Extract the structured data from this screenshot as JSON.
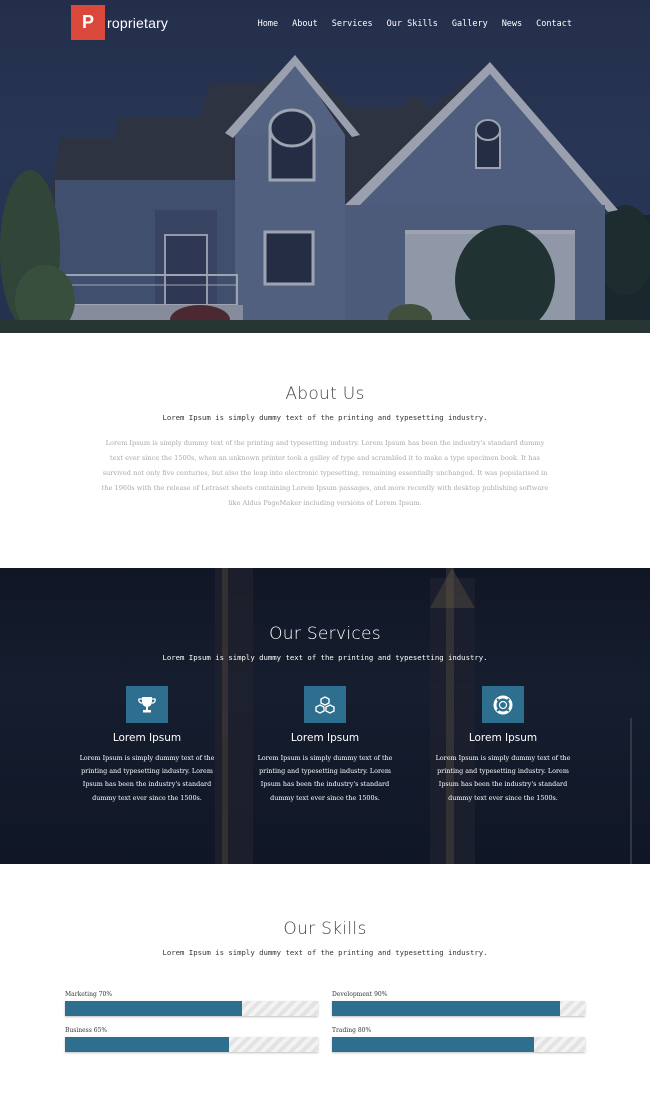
{
  "brand": {
    "initial": "P",
    "rest": "roprietary",
    "accent": "#d9483b"
  },
  "nav": [
    {
      "label": "Home"
    },
    {
      "label": "About"
    },
    {
      "label": "Services"
    },
    {
      "label": "Our Skills"
    },
    {
      "label": "Gallery"
    },
    {
      "label": "News"
    },
    {
      "label": "Contact"
    }
  ],
  "about": {
    "title": "About Us",
    "subtitle": "Lorem Ipsum is simply dummy text of the printing and typesetting industry.",
    "body": "Lorem Ipsum is simply dummy text of the printing and typesetting industry. Lorem Ipsum has been the industry's standard dummy text ever since the 1500s, when an unknown printer took a galley of type and scrambled it to make a type specimen book. It has survived not only five centuries, but also the leap into electronic typesetting, remaining essentially unchanged. It was popularised in the 1960s with the release of Letraset sheets containing Lorem Ipsum passages, and more recently with desktop publishing software like Aldus PageMaker including versions of Lorem Ipsum."
  },
  "services": {
    "title": "Our Services",
    "subtitle": "Lorem Ipsum is simply dummy text of the printing and typesetting industry.",
    "items": [
      {
        "icon": "trophy-icon",
        "title": "Lorem Ipsum",
        "text": "Lorem Ipsum is simply dummy text of the printing and typesetting industry. Lorem Ipsum has been the industry's standard dummy text ever since the 1500s."
      },
      {
        "icon": "cubes-icon",
        "title": "Lorem Ipsum",
        "text": "Lorem Ipsum is simply dummy text of the printing and typesetting industry. Lorem Ipsum has been the industry's standard dummy text ever since the 1500s."
      },
      {
        "icon": "life-ring-icon",
        "title": "Lorem Ipsum",
        "text": "Lorem Ipsum is simply dummy text of the printing and typesetting industry. Lorem Ipsum has been the industry's standard dummy text ever since the 1500s."
      }
    ],
    "icon_color": "#2e6e8e"
  },
  "skills": {
    "title": "Our Skills",
    "subtitle": "Lorem Ipsum is simply dummy text of the printing and typesetting industry.",
    "items": [
      {
        "label": "Marketing 70%",
        "percent": 70
      },
      {
        "label": "Development 90%",
        "percent": 90
      },
      {
        "label": "Business 65%",
        "percent": 65
      },
      {
        "label": "Trading 80%",
        "percent": 80
      }
    ],
    "bar_color": "#2e6e8e"
  }
}
